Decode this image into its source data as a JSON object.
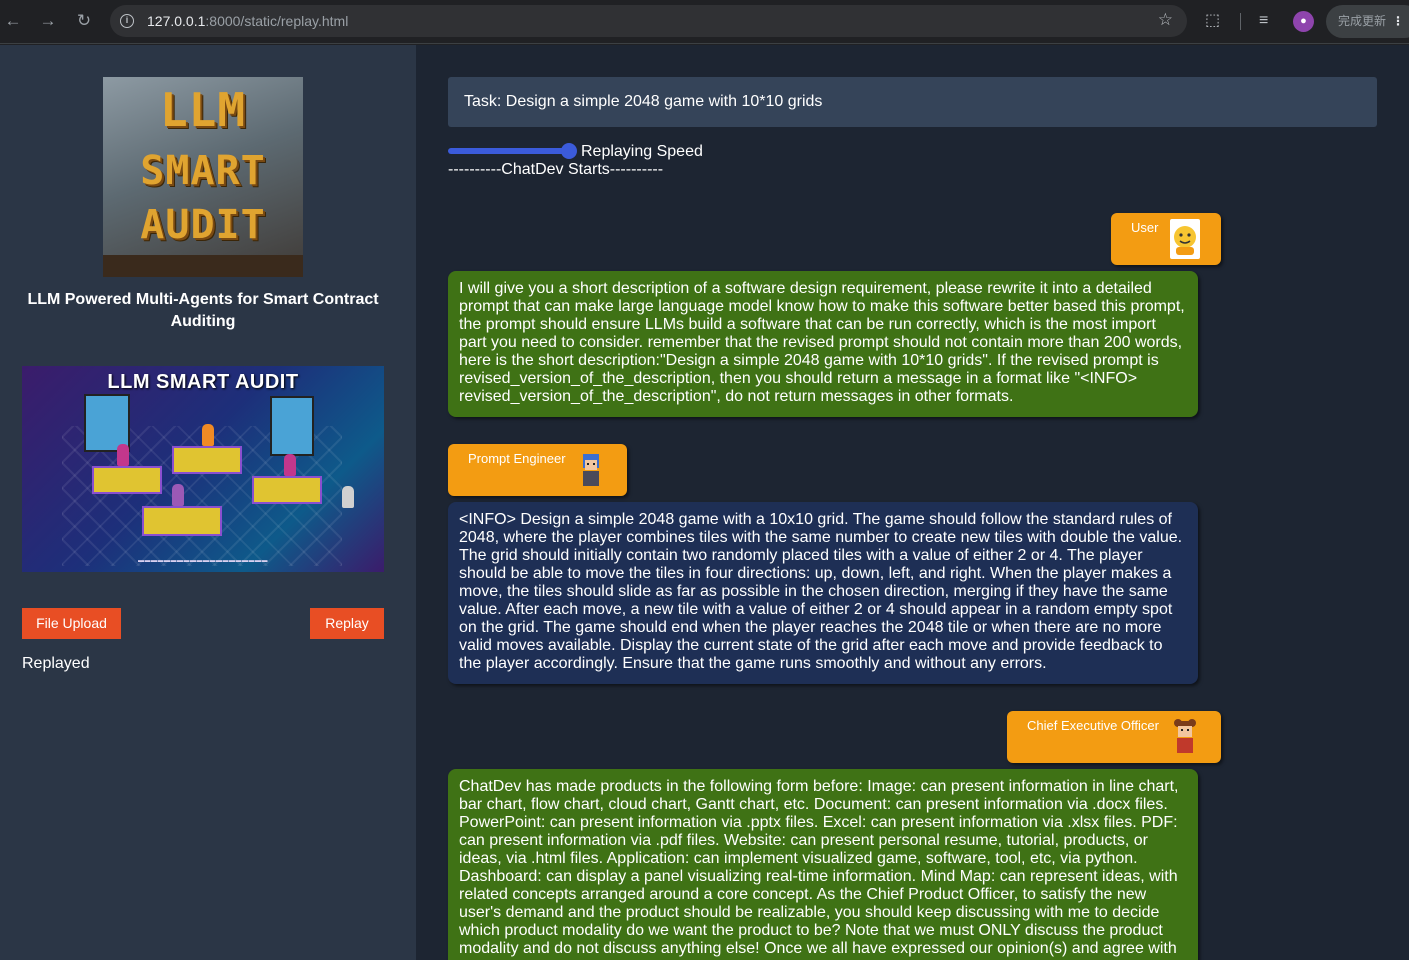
{
  "browser": {
    "url_host": "127.0.0.1",
    "url_path": ":8000/static/replay.html",
    "update_label": "完成更新"
  },
  "sidebar": {
    "logo_lines": [
      "LLM",
      "SMART",
      "AUDIT"
    ],
    "title": "LLM Powered Multi-Agents for Smart Contract Auditing",
    "banner_title": "LLM SMART AUDIT",
    "file_upload_label": "File Upload",
    "replay_label": "Replay",
    "status": "Replayed"
  },
  "main": {
    "task": "Task: Design a simple 2048 game with 10*10 grids",
    "speed_label": "Replaying Speed",
    "speed_fraction": 1.0,
    "starts_label": "----------ChatDev Starts----------",
    "messages": [
      {
        "role": "User",
        "text": "I will give you a short description of a software design requirement, please rewrite it into a detailed prompt that can make large language model know how to make this software better based this prompt, the prompt should ensure LLMs build a software that can be run correctly, which is the most import part you need to consider. remember that the revised prompt should not contain more than 200 words, here is the short description:\"Design a simple 2048 game with 10*10 grids\". If the revised prompt is revised_version_of_the_description, then you should return a message in a format like \"<INFO> revised_version_of_the_description\", do not return messages in other formats."
      },
      {
        "role": "Prompt Engineer",
        "text": "<INFO> Design a simple 2048 game with a 10x10 grid. The game should follow the standard rules of 2048, where the player combines tiles with the same number to create new tiles with double the value. The grid should initially contain two randomly placed tiles with a value of either 2 or 4. The player should be able to move the tiles in four directions: up, down, left, and right. When the player makes a move, the tiles should slide as far as possible in the chosen direction, merging if they have the same value. After each move, a new tile with a value of either 2 or 4 should appear in a random empty spot on the grid. The game should end when the player reaches the 2048 tile or when there are no more valid moves available. Display the current state of the grid after each move and provide feedback to the player accordingly. Ensure that the game runs smoothly and without any errors."
      },
      {
        "role": "Chief Executive Officer",
        "text": "ChatDev has made products in the following form before: Image: can present information in line chart, bar chart, flow chart, cloud chart, Gantt chart, etc. Document: can present information via .docx files. PowerPoint: can present information via .pptx files. Excel: can present information via .xlsx files. PDF: can present information via .pdf files. Website: can present personal resume, tutorial, products, or ideas, via .html files. Application: can implement visualized game, software, tool, etc, via python. Dashboard: can display a panel visualizing real-time information. Mind Map: can represent ideas, with related concepts arranged around a core concept. As the Chief Product Officer, to satisfy the new user's demand and the product should be realizable, you should keep discussing with me to decide which product modality do we want the product to be? Note that we must ONLY discuss the product modality and do not discuss anything else! Once we all have expressed our opinion(s) and agree with"
      }
    ]
  }
}
